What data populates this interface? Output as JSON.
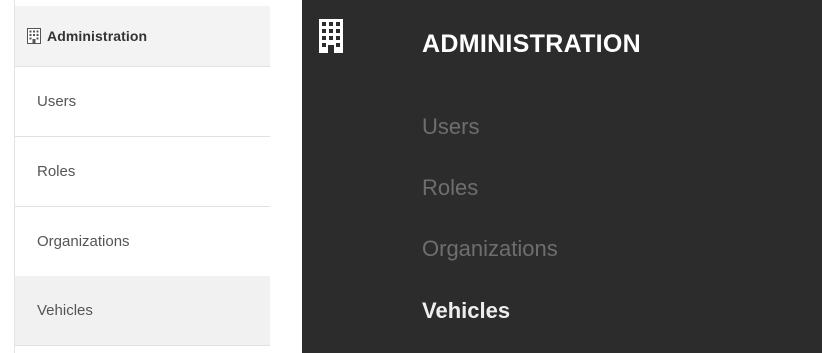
{
  "light_menu": {
    "header_icon": "building-icon",
    "title": "Administration",
    "items": [
      {
        "label": "Users",
        "active": false
      },
      {
        "label": "Roles",
        "active": false
      },
      {
        "label": "Organizations",
        "active": false
      },
      {
        "label": "Vehicles",
        "active": true
      }
    ]
  },
  "dark_menu": {
    "header_icon": "building-icon",
    "title": "ADMINISTRATION",
    "items": [
      {
        "label": "Users",
        "active": false
      },
      {
        "label": "Roles",
        "active": false
      },
      {
        "label": "Organizations",
        "active": false
      },
      {
        "label": "Vehicles",
        "active": true
      }
    ]
  },
  "colors": {
    "light_bg": "#ffffff",
    "light_header_bg": "#f3f3f3",
    "light_active_bg": "#f1f1f1",
    "light_divider": "#e1e1e1",
    "dark_bg": "#2c2c2c",
    "dark_inactive_text": "#6e6e6e",
    "dark_active_text": "#eeeeee"
  }
}
